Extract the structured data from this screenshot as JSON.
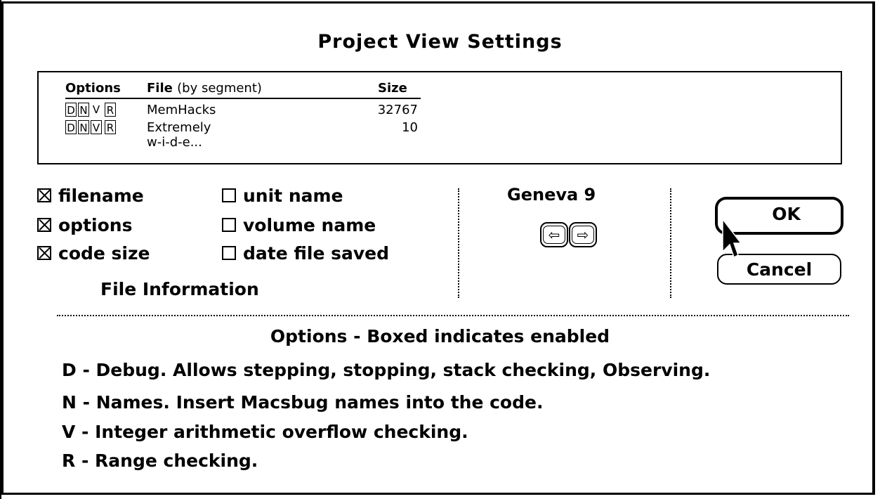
{
  "dialog": {
    "title": "Project View Settings"
  },
  "list": {
    "headers": {
      "options": "Options",
      "file": "File",
      "file_note": "(by segment)",
      "size": "Size"
    },
    "rows": [
      {
        "flags": [
          "D",
          "N",
          "V",
          "R"
        ],
        "boxed": [
          true,
          true,
          false,
          true
        ],
        "file": "MemHacks",
        "size": "32767"
      },
      {
        "flags": [
          "D",
          "N",
          "V",
          "R"
        ],
        "boxed": [
          true,
          true,
          true,
          true
        ],
        "file": "Extremely w-i-d-e...",
        "size": "10"
      }
    ]
  },
  "checkboxes": [
    {
      "label": "filename",
      "checked": true
    },
    {
      "label": "options",
      "checked": true
    },
    {
      "label": "code size",
      "checked": true
    },
    {
      "label": "unit name",
      "checked": false
    },
    {
      "label": "volume name",
      "checked": false
    },
    {
      "label": "date file saved",
      "checked": false
    }
  ],
  "file_info_label": "File Information",
  "font": {
    "label": "Geneva 9",
    "left_arrow": "⇦",
    "right_arrow": "⇨",
    "left_arrow_icon": "left-arrow-icon",
    "right_arrow_icon": "right-arrow-icon"
  },
  "buttons": {
    "ok": "OK",
    "cancel": "Cancel"
  },
  "legend": {
    "title": "Options - Boxed indicates enabled",
    "items": [
      "D - Debug.  Allows stepping, stopping, stack checking, Observing.",
      "N - Names.  Insert Macsbug names into the code.",
      "V - Integer arithmetic overflow checking.",
      "R - Range checking."
    ]
  }
}
